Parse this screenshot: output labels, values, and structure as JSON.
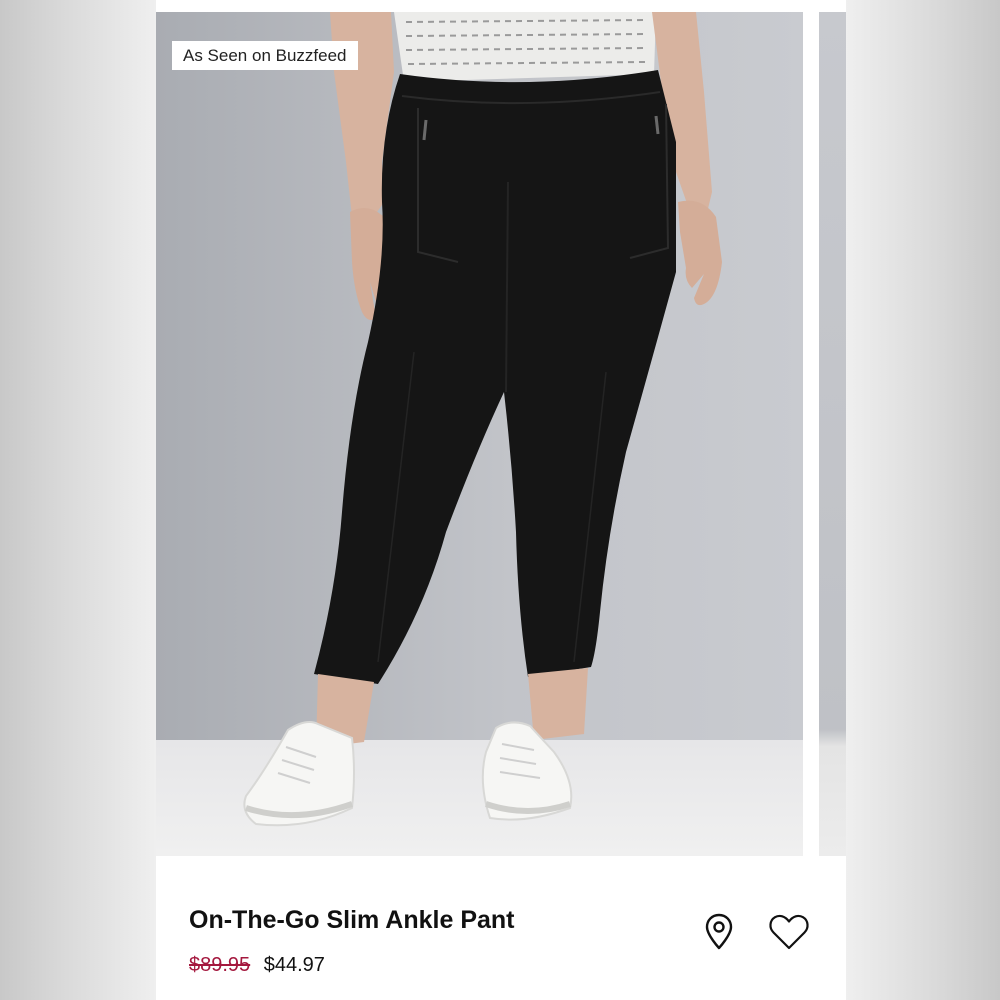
{
  "product": {
    "badge": "As Seen on Buzzfeed",
    "name": "On-The-Go Slim Ankle Pant",
    "price_original": "$89.95",
    "price_sale": "$44.97"
  },
  "icons": {
    "store": "location-pin-icon",
    "favorite": "heart-icon"
  },
  "colors": {
    "sale_strike": "#a4183e",
    "pants": "#151515",
    "background_wall": "#b9bcc2"
  }
}
